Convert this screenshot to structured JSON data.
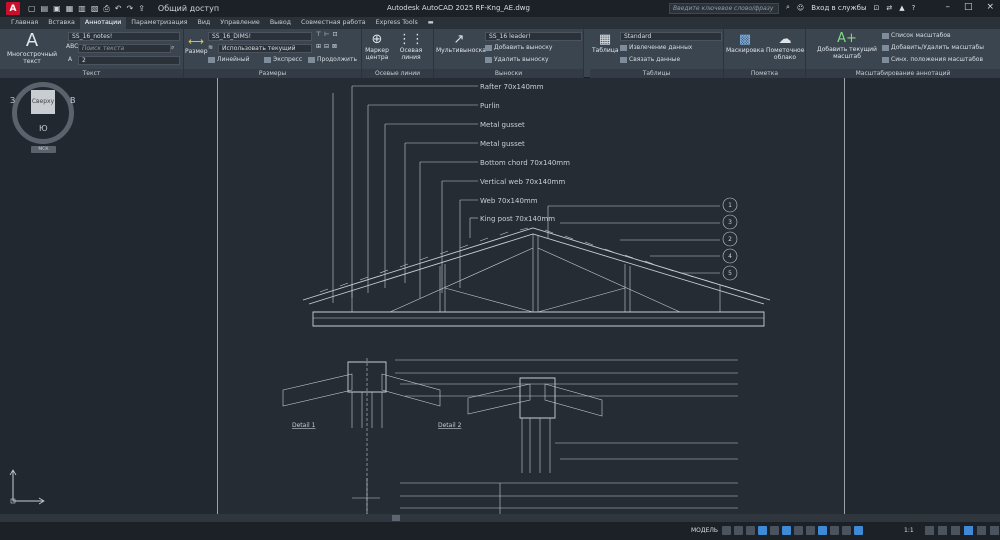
{
  "app": {
    "logo": "A",
    "title": "Autodesk AutoCAD 2025    RF-Kng_AE.dwg",
    "share": "Общий доступ",
    "search_placeholder": "Введите ключевое слово/фразу",
    "signin": "Вход в службы"
  },
  "tabs": [
    {
      "label": "Главная"
    },
    {
      "label": "Вставка"
    },
    {
      "label": "Аннотации"
    },
    {
      "label": "Параметризация"
    },
    {
      "label": "Вид"
    },
    {
      "label": "Управление"
    },
    {
      "label": "Вывод"
    },
    {
      "label": "Совместная работа"
    },
    {
      "label": "Express Tools"
    }
  ],
  "ribbon": {
    "text": {
      "label": "Текст",
      "mtext": "Многострочный текст",
      "style": "SS_16_notes!",
      "find": "Поиск текста",
      "height": "2"
    },
    "dims": {
      "label": "Размеры",
      "dim": "Размер",
      "style": "SS_16_DIMS!",
      "use_current": "Использовать текущий",
      "linear": "Линейный",
      "express": "Экспресс",
      "continue": "Продолжить"
    },
    "center": {
      "label": "Осевые линии",
      "mark": "Маркер центра",
      "axis": "Осевая линия"
    },
    "leaders": {
      "label": "Выноски",
      "multi": "Мультивыноска",
      "style": "SS_16 leader!",
      "add": "Добавить выноску",
      "remove": "Удалить выноску"
    },
    "tables": {
      "label": "Таблицы",
      "table": "Таблица",
      "style": "Standard",
      "extract": "Извлечение данных",
      "link": "Связать данные"
    },
    "markup": {
      "label": "Пометка",
      "mask": "Маскировка",
      "cloud": "Пометочное облако"
    },
    "scale": {
      "label": "Масштабирование аннотаций",
      "add": "Добавить текущий масштаб",
      "list": "Список масштабов",
      "addremove": "Добавить/Удалить масштабы",
      "sync": "Синх. положения масштабов"
    }
  },
  "viewcube": {
    "top": "Сверху",
    "west": "З",
    "east": "В",
    "south": "Ю",
    "ucs": "МСК"
  },
  "drawing": {
    "labels": [
      "Rafter 70x140mm",
      "Purlin",
      "Metal gusset",
      "Metal gusset",
      "Bottom chord 70x140mm",
      "Vertical web 70x140mm",
      "Web 70x140mm",
      "King post 70x140mm"
    ],
    "callouts": [
      "1",
      "3",
      "2",
      "4",
      "5"
    ],
    "detail1": "Detail 1",
    "detail2": "Detail 2"
  },
  "status": {
    "model": "МОДЕЛЬ",
    "scale": "1:1"
  },
  "colors": {
    "bg": "#212830",
    "ribbon": "#3b4550",
    "accent": "#3e8ad6",
    "logo": "#c8102e"
  }
}
